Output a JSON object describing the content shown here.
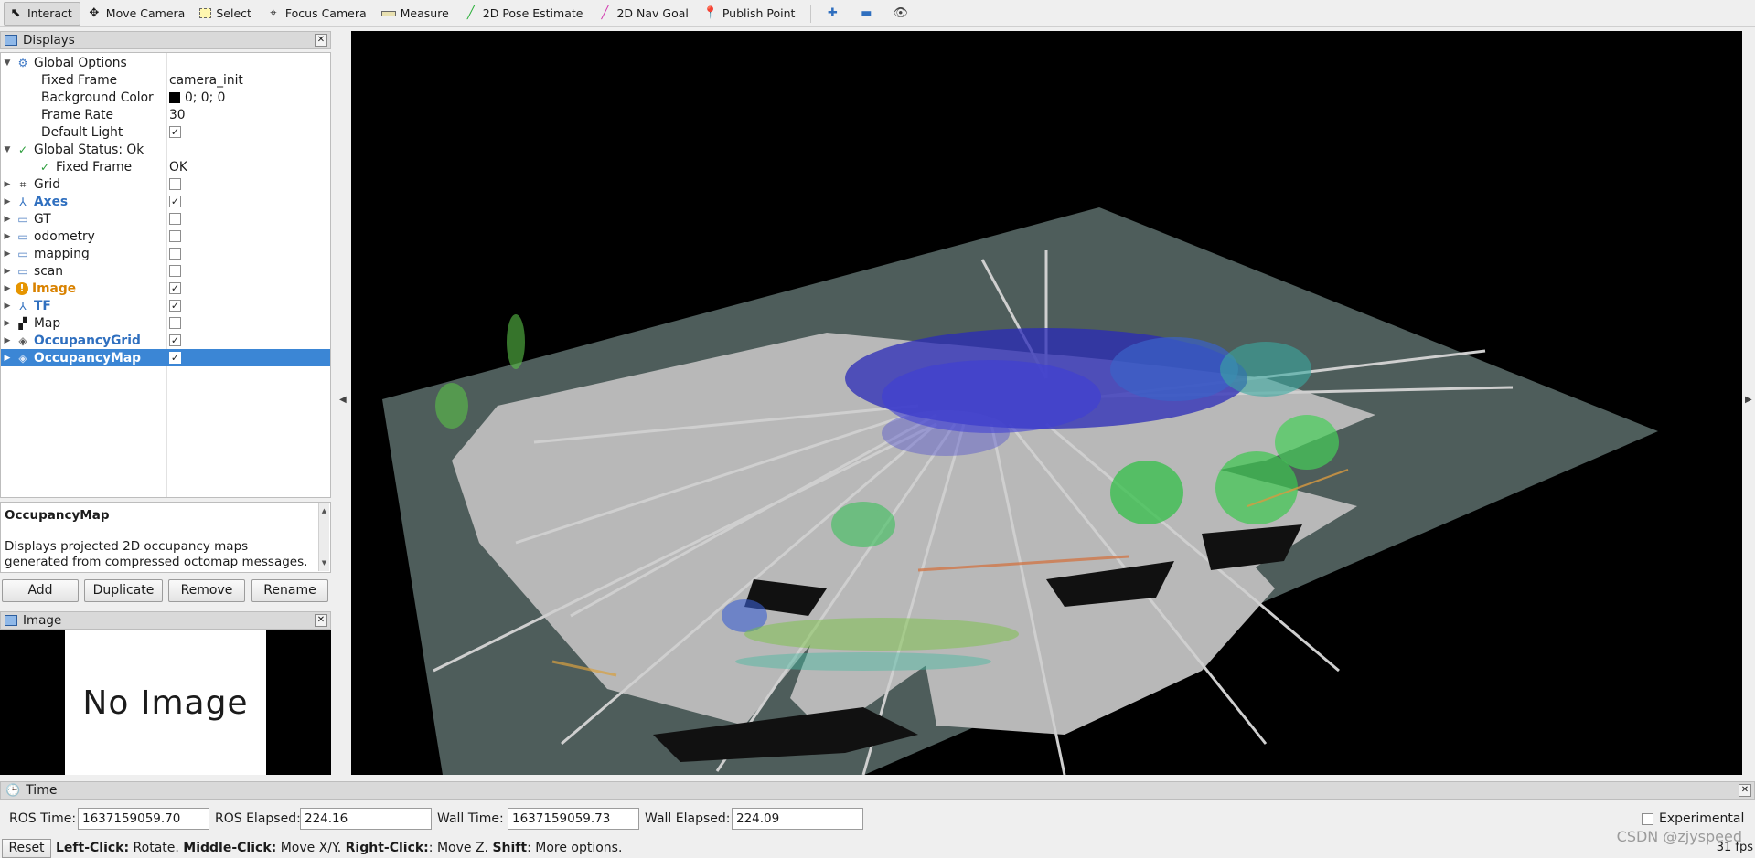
{
  "toolbar": {
    "tools": [
      {
        "label": "Interact",
        "icon": "cursor-icon"
      },
      {
        "label": "Move Camera",
        "icon": "move-camera-icon"
      },
      {
        "label": "Select",
        "icon": "select-icon"
      },
      {
        "label": "Focus Camera",
        "icon": "focus-camera-icon"
      },
      {
        "label": "Measure",
        "icon": "ruler-icon"
      },
      {
        "label": "2D Pose Estimate",
        "icon": "green-arrow-icon"
      },
      {
        "label": "2D Nav Goal",
        "icon": "pink-arrow-icon"
      },
      {
        "label": "Publish Point",
        "icon": "map-pin-icon"
      }
    ]
  },
  "displays": {
    "title": "Displays",
    "rows": [
      {
        "name": "Global Options",
        "value": ""
      },
      {
        "name": "Fixed Frame",
        "value": "camera_init"
      },
      {
        "name": "Background Color",
        "value": "0; 0; 0"
      },
      {
        "name": "Frame Rate",
        "value": "30"
      },
      {
        "name": "Default Light",
        "value": ""
      },
      {
        "name": "Global Status: Ok",
        "value": ""
      },
      {
        "name": "Fixed Frame",
        "value": "OK"
      },
      {
        "name": "Grid",
        "value": ""
      },
      {
        "name": "Axes",
        "value": ""
      },
      {
        "name": "GT",
        "value": ""
      },
      {
        "name": "odometry",
        "value": ""
      },
      {
        "name": "mapping",
        "value": ""
      },
      {
        "name": "scan",
        "value": ""
      },
      {
        "name": "Image",
        "value": ""
      },
      {
        "name": "TF",
        "value": ""
      },
      {
        "name": "Map",
        "value": ""
      },
      {
        "name": "OccupancyGrid",
        "value": ""
      },
      {
        "name": "OccupancyMap",
        "value": ""
      }
    ],
    "checked": {
      "default_light": true,
      "grid": false,
      "axes": true,
      "gt": false,
      "odometry": false,
      "mapping": false,
      "scan": false,
      "image": true,
      "tf": true,
      "map": false,
      "occupancy_grid": true,
      "occupancy_map": true
    }
  },
  "description": {
    "title": "OccupancyMap",
    "text": "Displays projected 2D occupancy maps generated from compressed octomap messages."
  },
  "buttons": {
    "add": "Add",
    "duplicate": "Duplicate",
    "remove": "Remove",
    "rename": "Rename"
  },
  "image_panel": {
    "title": "Image",
    "placeholder": "No Image"
  },
  "time_panel": {
    "title": "Time",
    "ros_time_label": "ROS Time:",
    "ros_time": "1637159059.70",
    "ros_elapsed_label": "ROS Elapsed:",
    "ros_elapsed": "224.16",
    "wall_time_label": "Wall Time:",
    "wall_time": "1637159059.73",
    "wall_elapsed_label": "Wall Elapsed:",
    "wall_elapsed": "224.09",
    "experimental_label": "Experimental"
  },
  "status_bar": {
    "reset": "Reset",
    "hint_left_click": "Left-Click:",
    "hint_left_action": " Rotate. ",
    "hint_middle_click": "Middle-Click:",
    "hint_middle_action": " Move X/Y. ",
    "hint_right_click": "Right-Click:",
    "hint_right_action": ": Move Z. ",
    "hint_shift": "Shift",
    "hint_shift_action": ": More options.",
    "fps": "31 fps"
  },
  "watermark": "CSDN @zjyspeed",
  "colors": {
    "selection": "#3b86d5",
    "ok_green": "#2a9d3a",
    "warn_orange": "#d98200",
    "map_plane": "#4e5d5b",
    "map_free": "#b5b5b5"
  }
}
